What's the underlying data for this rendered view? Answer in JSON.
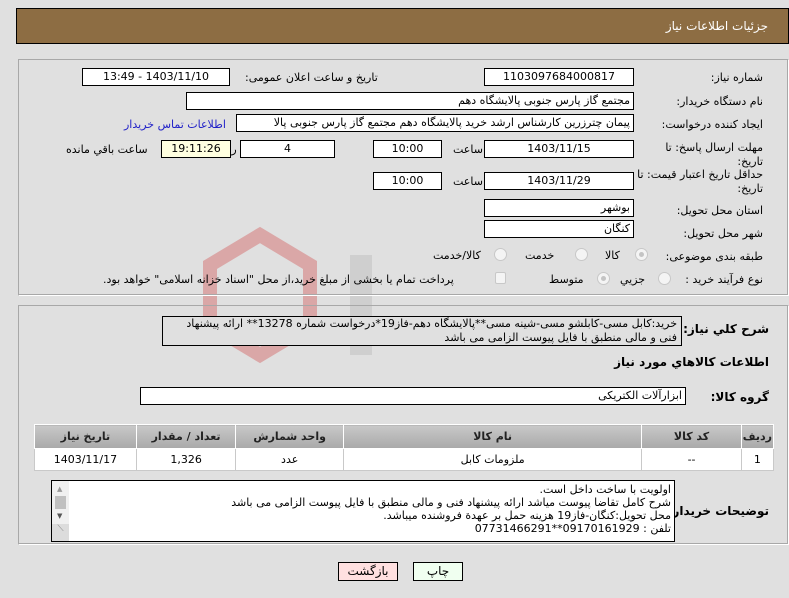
{
  "header": {
    "title": "جزئیات اطلاعات نیاز"
  },
  "fields": {
    "need_number_label": "شماره نیاز:",
    "need_number": "1103097684000817",
    "announce_label": "تاریخ و ساعت اعلان عمومی:",
    "announce_value": "1403/11/10 - 13:49",
    "buyer_org_label": "نام دستگاه خریدار:",
    "buyer_org": "مجتمع گاز پارس جنوبی  پالایشگاه دهم",
    "creator_label": "ایجاد کننده درخواست:",
    "creator": "پیمان چترزرین کارشناس ارشد خرید پالایشگاه دهم مجتمع گاز پارس جنوبی  پالا",
    "buyer_contact_link": "اطلاعات تماس خریدار",
    "deadline_label_1": "مهلت ارسال پاسخ: تا",
    "deadline_label_2": "تاریخ:",
    "deadline_date": "1403/11/15",
    "time_label": "ساعت",
    "deadline_time": "10:00",
    "days_remaining": "4",
    "days_label": "روز و",
    "time_remaining": "19:11:26",
    "time_remaining_label": "ساعت باقي مانده",
    "price_validity_label_1": "حداقل تاریخ اعتبار قیمت: تا",
    "price_validity_label_2": "تاریخ:",
    "price_validity_date": "1403/11/29",
    "price_validity_time": "10:00",
    "province_label": "استان محل تحویل:",
    "province": "بوشهر",
    "city_label": "شهر محل تحویل:",
    "city": "کنگان",
    "category_label": "طبقه بندی موضوعی:",
    "category_options": [
      "کالا",
      "خدمت",
      "کالا/خدمت"
    ],
    "category_selected": "کالا",
    "process_label": "نوع فرآیند خرید :",
    "process_options": [
      "جزیي",
      "متوسط"
    ],
    "process_selected": "متوسط",
    "treasury_note": "پرداخت تمام یا بخشی از مبلغ خرید،از محل \"اسناد خزانه اسلامی\" خواهد بود."
  },
  "summary": {
    "label": "شرح کلي نیاز:",
    "text": "خرید:کابل مسی-کابلشو مسی-شینه مسی**پالایشگاه دهم-فاز19*درخواست شماره 13278** ارائه پیشنهاد فنی و مالی منطبق با فایل پیوست الزامی می باشد"
  },
  "goods": {
    "section_title": "اطلاعات کالاهاي مورد نیاز",
    "group_label": "گروه کالا:",
    "group_value": "ابزارآلات الکتریکی",
    "columns": [
      "ردیف",
      "کد کالا",
      "نام کالا",
      "واحد شمارش",
      "تعداد / مقدار",
      "تاریخ نیاز"
    ],
    "rows": [
      [
        "1",
        "--",
        "ملزومات کابل",
        "عدد",
        "1,326",
        "1403/11/17"
      ]
    ]
  },
  "buyer_notes": {
    "label": "توضیحات خریدار:",
    "lines": [
      "اولویت با ساخت داخل است.",
      "شرح کامل تقاضا پیوست میاشد ارائه پیشنهاد فنی و مالی منطبق با فایل پیوست الزامی می باشد",
      "محل تحویل:کنگان-فاز19 هزینه حمل بر عهدة فروشنده میباشد.",
      "تلفن : 09170161929**07731466291"
    ]
  },
  "buttons": {
    "back": "بازگشت",
    "print": "چاپ"
  },
  "colors": {
    "header_bg": "#8d6d43",
    "back_bg": "#ffe0e0",
    "print_bg": "#f0fff0",
    "link": "#2121c8"
  }
}
